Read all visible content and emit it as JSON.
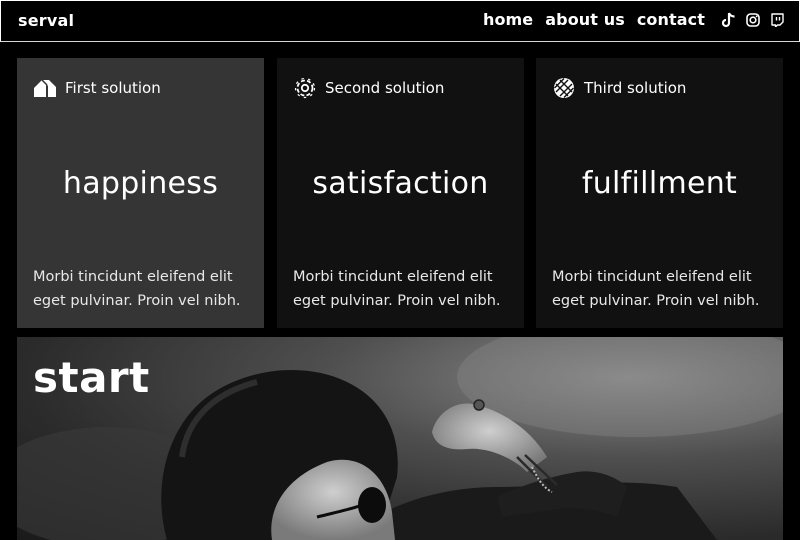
{
  "brand": {
    "logo": "serval"
  },
  "nav": {
    "links": [
      "home",
      "about us",
      "contact"
    ],
    "social_icons": [
      "tiktok-icon",
      "instagram-icon",
      "twitch-icon"
    ]
  },
  "cards": [
    {
      "title": "First solution",
      "icon": "house-icon",
      "word": "happiness",
      "text": "Morbi tincidunt eleifend elit eget pulvinar. Proin vel nibh."
    },
    {
      "title": "Second solution",
      "icon": "gear-icon",
      "word": "satisfaction",
      "text": "Morbi tincidunt eleifend elit eget pulvinar. Proin vel nibh."
    },
    {
      "title": "Third solution",
      "icon": "globe-icon",
      "word": "fulfillment",
      "text": "Morbi tincidunt eleifend elit eget pulvinar. Proin vel nibh."
    }
  ],
  "hero": {
    "title": "start"
  },
  "colors": {
    "page_bg": "#000000",
    "card_highlight": "#353535",
    "card_bg": "#111111",
    "text": "#ffffff"
  }
}
